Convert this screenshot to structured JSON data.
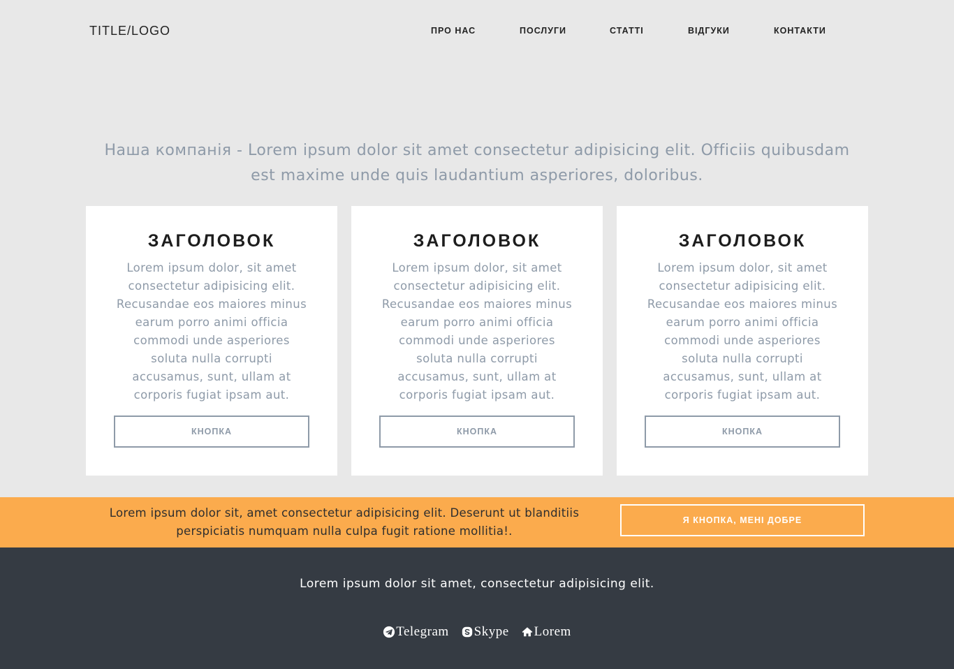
{
  "header": {
    "logo": "TITLE/LOGO",
    "nav": [
      "ПРО НАС",
      "ПОСЛУГИ",
      "СТАТТІ",
      "ВІДГУКИ",
      "КОНТАКТИ"
    ]
  },
  "intro": {
    "line1": "Наша компанія - Lorem ipsum dolor sit amet consectetur adipisicing elit. Officiis quibusdam",
    "line2": "est maxime unde quis laudantium asperiores, doloribus."
  },
  "cards": [
    {
      "title": "ЗАГОЛОВОК",
      "text": "Lorem ipsum dolor, sit amet consectetur adipisicing elit. Recusandae eos maiores minus earum porro animi officia commodi unde asperiores soluta nulla corrupti accusamus, sunt, ullam at corporis fugiat ipsam aut.",
      "button": "КНОПКА"
    },
    {
      "title": "ЗАГОЛОВОК",
      "text": "Lorem ipsum dolor, sit amet consectetur adipisicing elit. Recusandae eos maiores minus earum porro animi officia commodi unde asperiores soluta nulla corrupti accusamus, sunt, ullam at corporis fugiat ipsam aut.",
      "button": "КНОПКА"
    },
    {
      "title": "ЗАГОЛОВОК",
      "text": "Lorem ipsum dolor, sit amet consectetur adipisicing elit. Recusandae eos maiores minus earum porro animi officia commodi unde asperiores soluta nulla corrupti accusamus, sunt, ullam at corporis fugiat ipsam aut.",
      "button": "КНОПКА"
    }
  ],
  "banner": {
    "text": "Lorem ipsum dolor sit, amet consectetur adipisicing elit. Deserunt ut blanditiis perspiciatis numquam nulla culpa fugit ratione mollitia!.",
    "button": "Я КНОПКА, МЕНІ ДОБРЕ"
  },
  "footer": {
    "text": "Lorem ipsum dolor sit amet, consectetur adipisicing elit.",
    "links": [
      {
        "label": "Telegram",
        "icon": "telegram-icon"
      },
      {
        "label": "Skype",
        "icon": "skype-icon"
      },
      {
        "label": "Lorem",
        "icon": "home-icon"
      }
    ]
  },
  "colors": {
    "background": "#e8e8e8",
    "card": "#ffffff",
    "muted_text": "#8e9aa8",
    "banner": "#fbab4d",
    "footer": "#353b43"
  }
}
